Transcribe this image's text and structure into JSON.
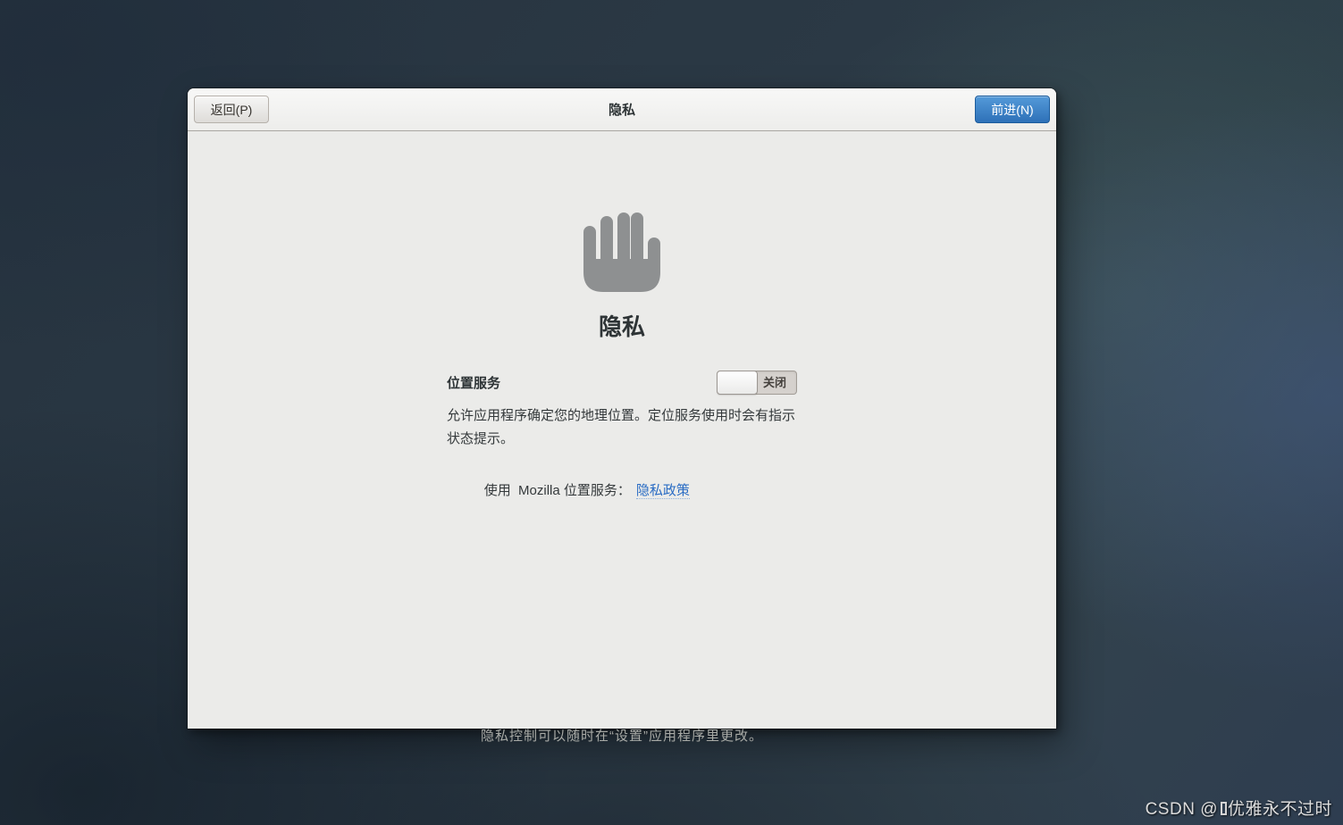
{
  "window": {
    "title": "隐私",
    "back_button": "返回(P)",
    "forward_button": "前进(N)"
  },
  "privacy": {
    "heading": "隐私",
    "icon": "stop-hand-icon",
    "location": {
      "label": "位置服务",
      "switch_state": "关闭",
      "description": "允许应用程序确定您的地理位置。定位服务使用时会有指示状态提示。",
      "provider_text": "使用  Mozilla 位置服务：",
      "policy_link": "隐私政策"
    },
    "footer_note": "隐私控制可以随时在“设置”应用程序里更改。"
  },
  "watermark": {
    "prefix": "CSDN @",
    "suffix": "优雅永不过时"
  },
  "colors": {
    "accent_blue": "#3584c8",
    "link_blue": "#2a6cc4",
    "dialog_bg": "#ebebe9",
    "icon_gray": "#8e9091"
  }
}
